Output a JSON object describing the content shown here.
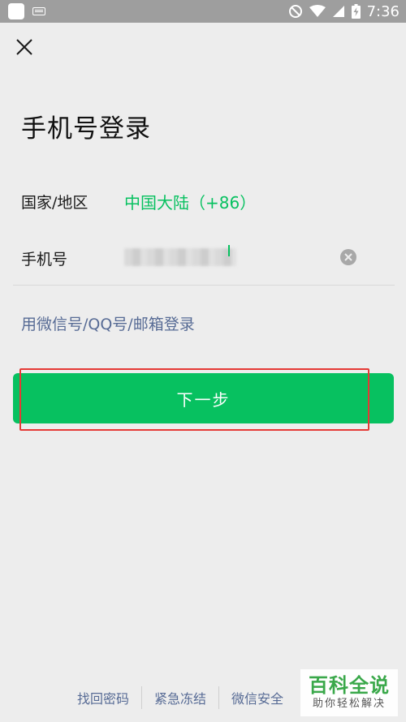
{
  "status_bar": {
    "time": "7:36",
    "icons": [
      "app-icon",
      "keyboard-icon",
      "do-not-disturb-icon",
      "wifi-icon",
      "signal-icon",
      "battery-charging-icon"
    ]
  },
  "header": {
    "close_icon": "close-icon",
    "title": "手机号登录"
  },
  "form": {
    "region_label": "国家/地区",
    "region_value": "中国大陆（+86）",
    "phone_label": "手机号",
    "phone_value_masked": true,
    "clear_icon": "clear-icon"
  },
  "alt_login": "用微信号/QQ号/邮箱登录",
  "next_button": "下一步",
  "footer": {
    "links": [
      "找回密码",
      "紧急冻结",
      "微信安全"
    ]
  },
  "watermark": {
    "title": "百科全说",
    "subtitle": "助你轻松解决"
  },
  "colors": {
    "accent": "#07c160",
    "link": "#576b95",
    "background": "#ededed",
    "highlight": "#e53935"
  }
}
